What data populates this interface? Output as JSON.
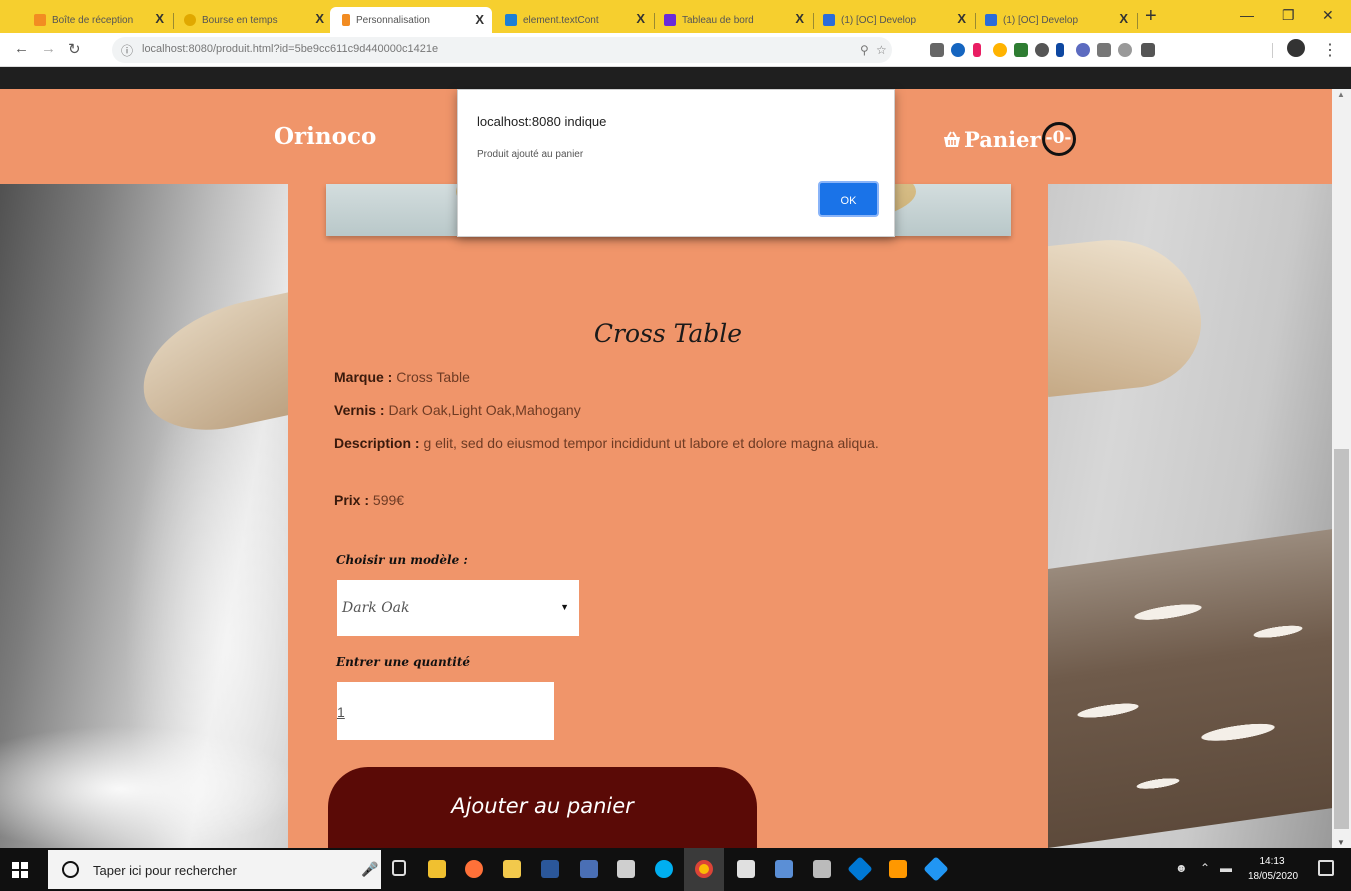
{
  "browser": {
    "tabs": [
      {
        "label": "Boîte de réception",
        "color": "#f28c22"
      },
      {
        "label": "Bourse en temps",
        "color": "#f6cf2e"
      },
      {
        "label": "Personnalisation",
        "color": "#f28c22"
      },
      {
        "label": "element.textCont",
        "color": "#1d7fd4"
      },
      {
        "label": "Tableau de bord",
        "color": "#6a2bd9"
      },
      {
        "label": "(1) [OC] Develop",
        "color": "#2b6cd9"
      },
      {
        "label": "(1) [OC] Develop",
        "color": "#2b6cd9"
      }
    ],
    "active_tab_index": 2,
    "new_tab_label": "+",
    "close_glyph": "X",
    "url": "localhost:8080/produit.html?id=5be9cc611c9d440000c1421e"
  },
  "site": {
    "brand": "Orinoco",
    "cart_label": "Panier",
    "cart_count": "-0-"
  },
  "product": {
    "name": "Cross Table",
    "brand_label": "Marque :",
    "brand_value": "Cross Table",
    "varnish_label": "Vernis :",
    "varnish_value": "Dark Oak,Light Oak,Mahogany",
    "description_label": "Description :",
    "description_value": "g elit, sed do eiusmod tempor incididunt ut labore et dolore magna aliqua.",
    "price_label": "Prix :",
    "price_value": "599€",
    "model_label": "Choisir un modèle :",
    "selected_model": "Dark Oak",
    "quantity_label": "Entrer une quantité",
    "quantity_value": "1",
    "add_button": "Ajouter au panier"
  },
  "dialog": {
    "title": "localhost:8080 indique",
    "message": "Produit ajouté au panier",
    "ok": "OK"
  },
  "taskbar": {
    "search_placeholder": "Taper ici pour rechercher",
    "time": "14:13",
    "date": "18/05/2020"
  }
}
